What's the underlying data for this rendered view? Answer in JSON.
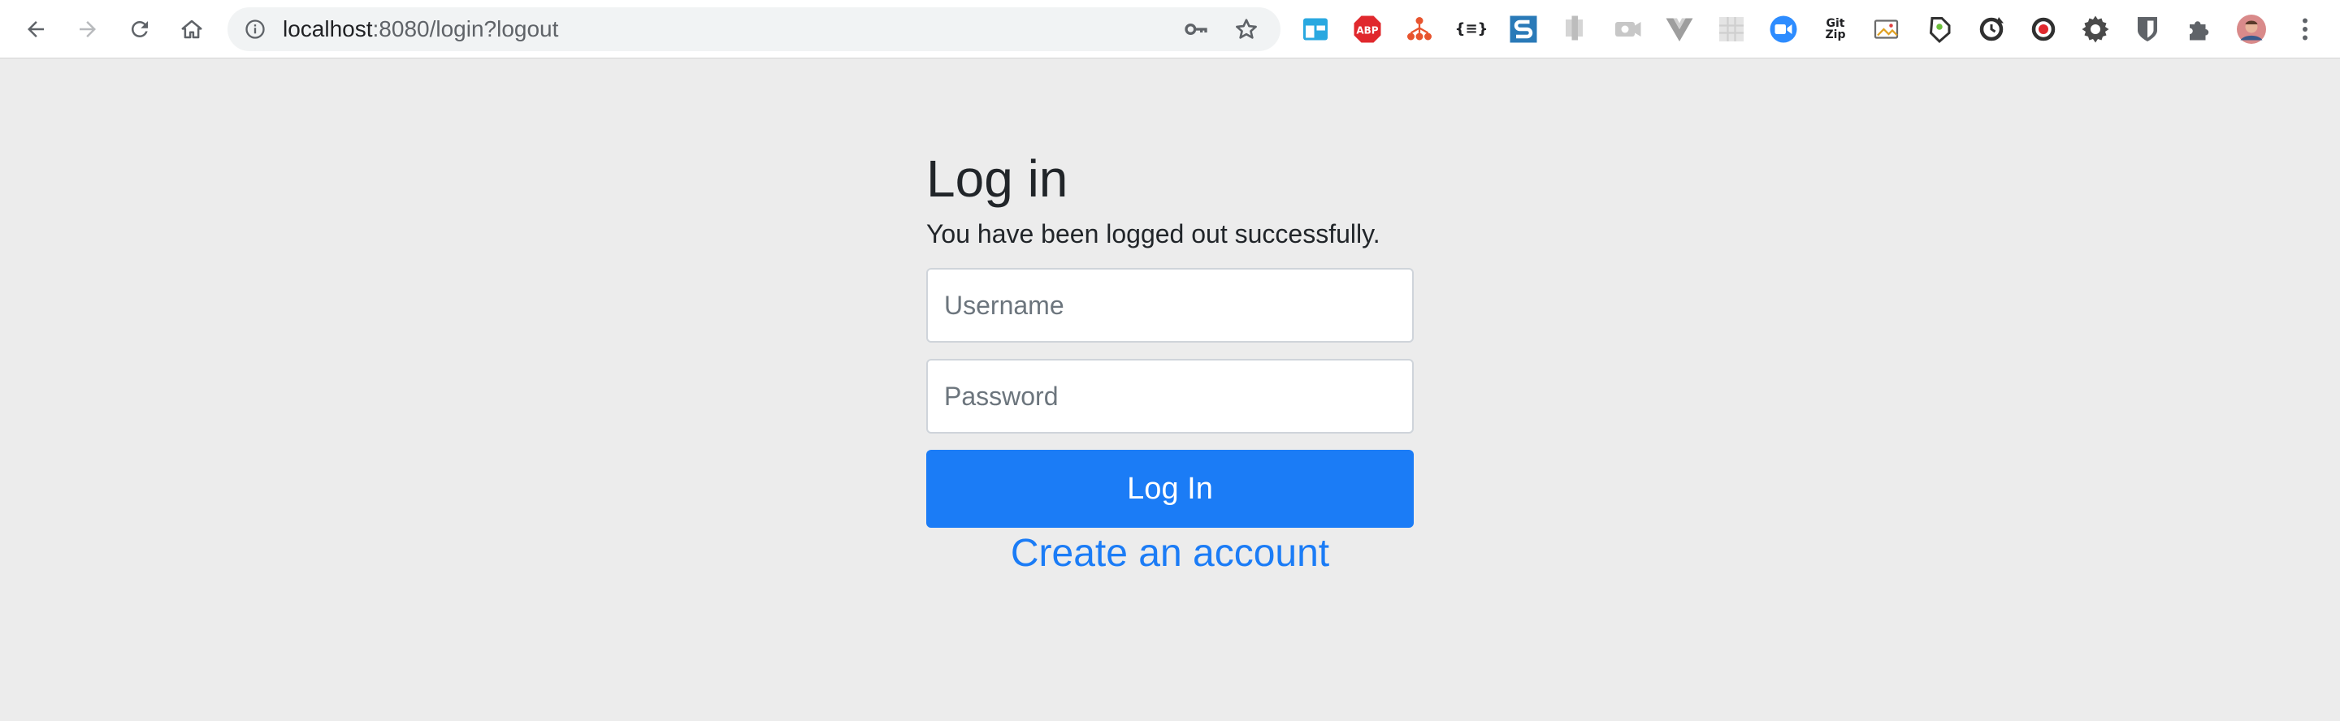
{
  "browser": {
    "url_host": "localhost",
    "url_rest": ":8080/login?logout",
    "extensions": [
      {
        "name": "abp-icon",
        "text": "ABP",
        "color": "#e0282d"
      },
      {
        "name": "gitzip-icon",
        "text_line1": "Git",
        "text_line2": "Zip"
      },
      {
        "name": "json-formatter-icon",
        "text": "{≡}"
      }
    ],
    "colors": {
      "toolbar": "#ffffff",
      "omnibox": "#f1f3f4",
      "icon": "#5f6368"
    }
  },
  "login": {
    "title": "Log in",
    "message": "You have been logged out successfully.",
    "username_placeholder": "Username",
    "password_placeholder": "Password",
    "submit_label": "Log In",
    "create_account_label": "Create an account"
  },
  "theme": {
    "background": "#ececec",
    "primary": "#1b7cf6",
    "text": "#212529"
  }
}
